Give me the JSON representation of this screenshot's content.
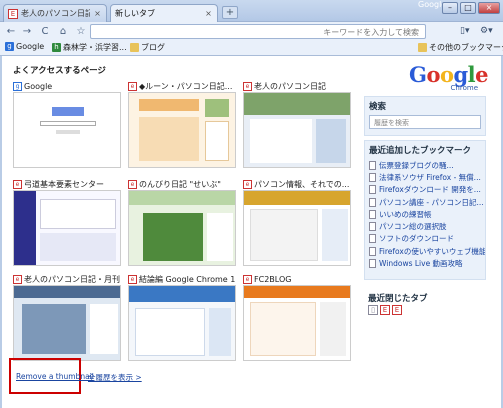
{
  "window": {
    "brand": "Google",
    "controls": [
      "–",
      "□",
      "×"
    ]
  },
  "tabs": [
    {
      "title": "老人のパソコン日記",
      "favicon": "E",
      "active": false
    },
    {
      "title": "新しいタブ",
      "favicon": "",
      "active": true
    }
  ],
  "new_tab_button": "+",
  "toolbar": {
    "back": "←",
    "forward": "→",
    "reload": "C",
    "home": "⌂",
    "star": "☆",
    "omnibox_placeholder": "キーワードを入力して検索",
    "page_menu": "▯▾",
    "tools_menu": "⚙▾"
  },
  "bookmarks_bar": {
    "items": [
      {
        "label": "Google",
        "icon": "g"
      },
      {
        "label": "森林学・浜学習...",
        "icon": "h"
      },
      {
        "label": "ブログ",
        "icon": "folder"
      }
    ],
    "other": "その他のブックマーク"
  },
  "most_visited": {
    "heading": "よくアクセスするページ",
    "thumbnails": [
      {
        "title": "Google",
        "favicon": "g"
      },
      {
        "title": "◆ルーン・パソコン日記...",
        "favicon": "e"
      },
      {
        "title": "老人のパソコン日記",
        "favicon": "e"
      },
      {
        "title": "弓道基本要素センター",
        "favicon": "e"
      },
      {
        "title": "のんびり日記 \"せいぶ\"",
        "favicon": "e"
      },
      {
        "title": "パソコン情報、それでの...",
        "favicon": "e"
      },
      {
        "title": "老人のパソコン日記・月刊",
        "favicon": "e"
      },
      {
        "title": "結論編 Google Chrome 1...",
        "favicon": "e"
      },
      {
        "title": "FC2BLOG",
        "favicon": "e"
      }
    ],
    "remove_link": "Remove a thumbnail",
    "show_all_link": "全履歴を表示 >"
  },
  "logo": {
    "text": "Google",
    "sub": "Chrome",
    "colors": [
      "#2a5bd7",
      "#d8312a",
      "#f3b41c",
      "#2a5bd7",
      "#2f9a3d",
      "#d8312a"
    ]
  },
  "search_panel": {
    "title": "検索",
    "placeholder": "履歴を検索"
  },
  "recent_bookmarks": {
    "title": "最近追加したブックマーク",
    "items": [
      "伝票登録ブログの騒...",
      "法律系ソウザ Firefox - 無償...",
      "Firefoxダウンロード 開発を...",
      "パソコン講座 - パソコン日記...",
      "いいめの練習帳",
      "パソコン総の選択肢",
      "ソフトのダウンロード",
      "Firefoxの使いやすいウェブ機能",
      "Windows Live 動画攻略"
    ]
  },
  "closed_tabs": {
    "title": "最近閉じたタブ"
  }
}
